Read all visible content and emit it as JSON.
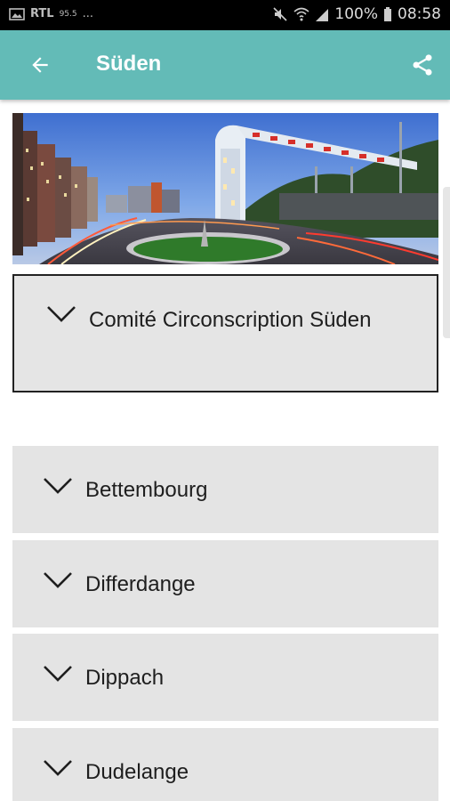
{
  "status_bar": {
    "left_text": "RTL",
    "left_small": "95.5",
    "dots": "...",
    "battery": "100%",
    "time": "08:58"
  },
  "app_bar": {
    "title": "Süden",
    "back_icon": "arrow-left-icon",
    "share_icon": "share-icon"
  },
  "hero_image": {
    "description_icon": "city-photo"
  },
  "sections": {
    "comite": {
      "label": "Comité Circonscription Süden"
    },
    "items": [
      {
        "label": "Bettembourg"
      },
      {
        "label": "Differdange"
      },
      {
        "label": "Dippach"
      },
      {
        "label": "Dudelange"
      }
    ]
  },
  "colors": {
    "accent": "#63bbb7",
    "item_bg": "#e4e4e4",
    "text": "#1e1e1e"
  }
}
